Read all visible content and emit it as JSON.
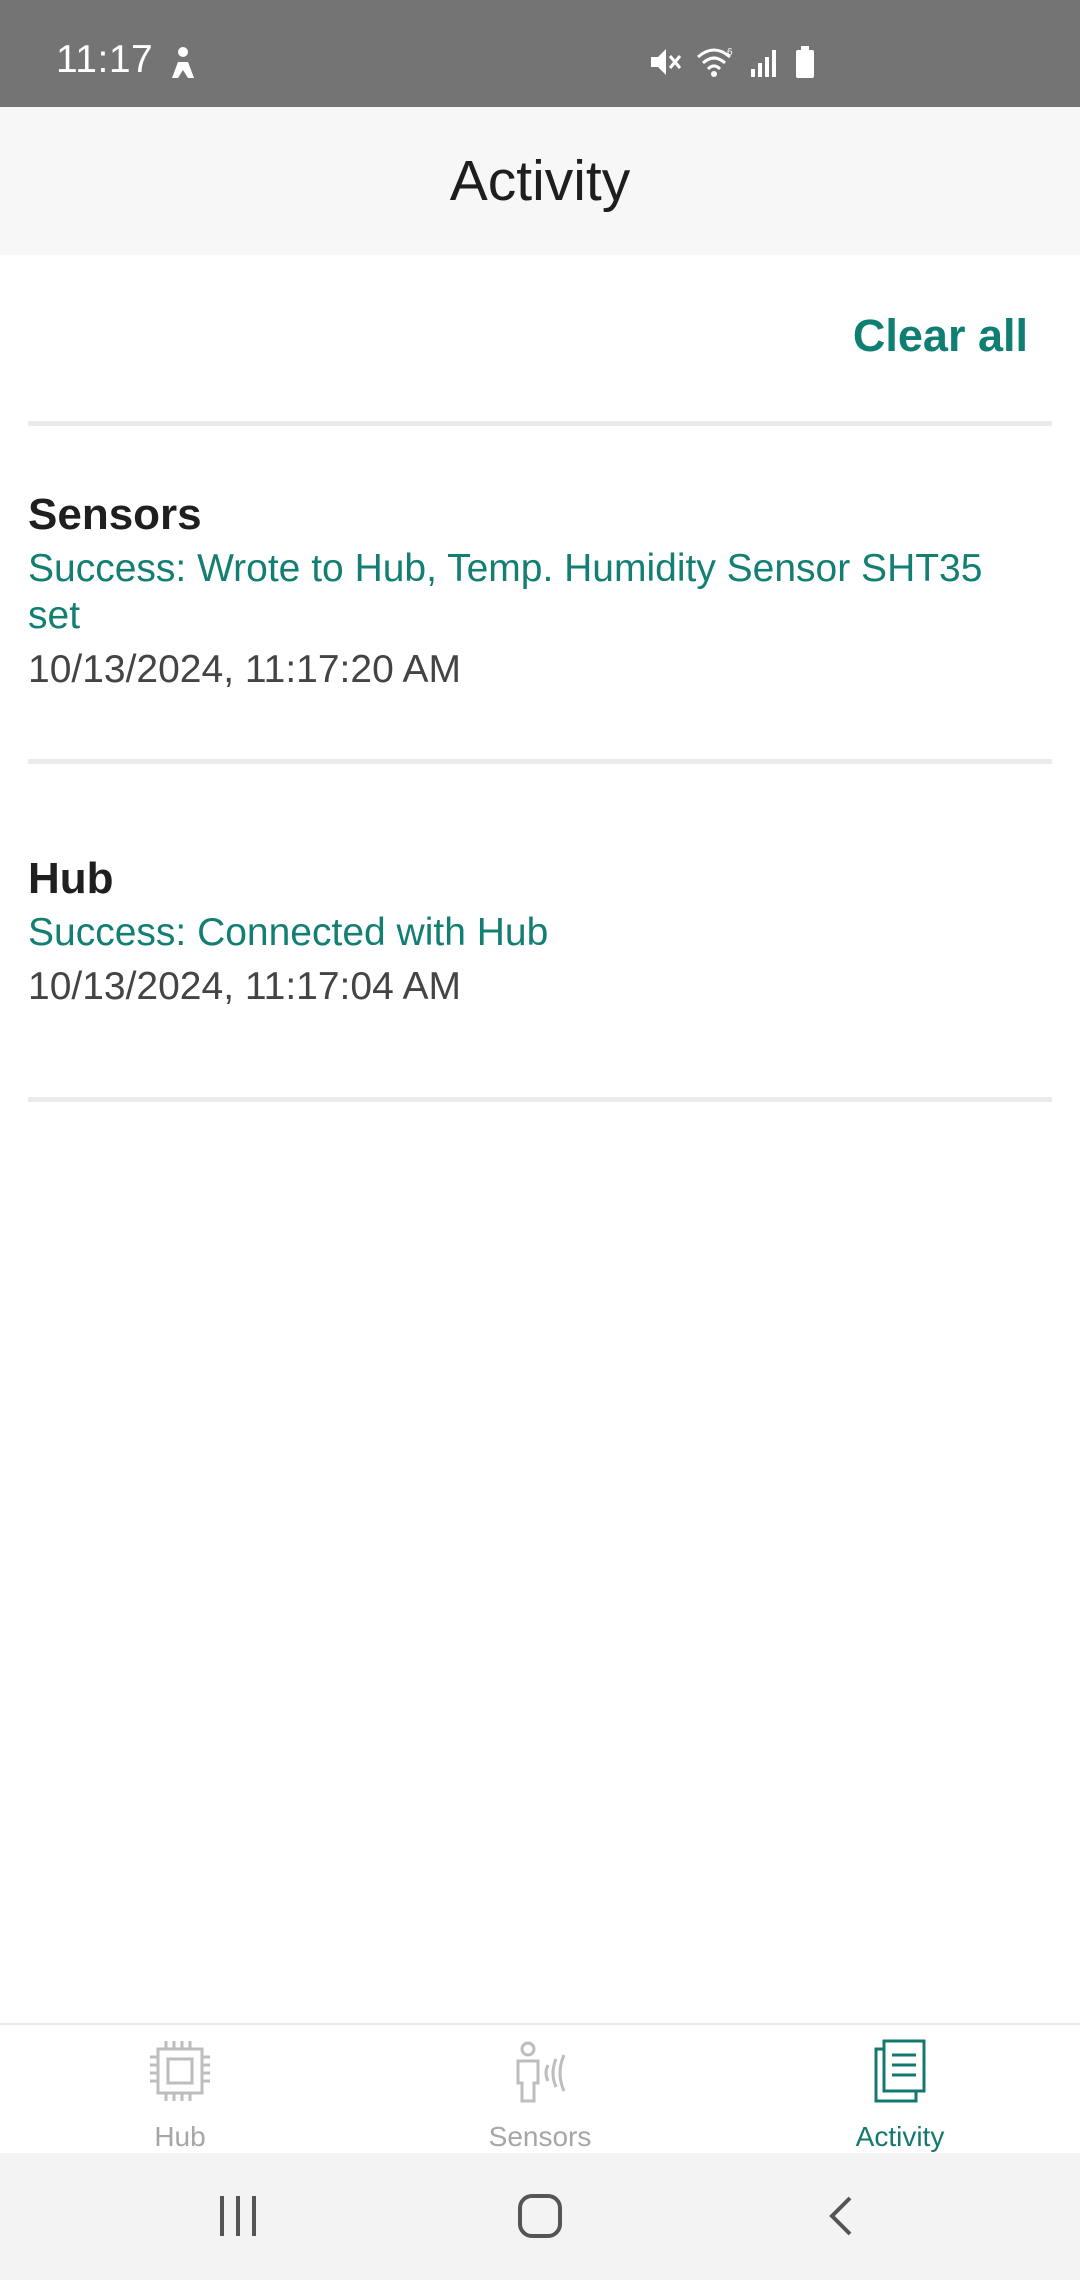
{
  "status_bar": {
    "time": "11:17",
    "icons": [
      "accessibility-icon",
      "mute-icon",
      "wifi-icon",
      "signal-icon",
      "battery-icon"
    ]
  },
  "header": {
    "title": "Activity"
  },
  "actions": {
    "clear_all": "Clear all"
  },
  "activity": [
    {
      "source": "Sensors",
      "message": "Success: Wrote to Hub, Temp. Humidity Sensor SHT35 set",
      "time": "10/13/2024, 11:17:20 AM"
    },
    {
      "source": "Hub",
      "message": "Success: Connected with Hub",
      "time": "10/13/2024, 11:17:04 AM"
    }
  ],
  "bottom_nav": {
    "items": [
      {
        "label": "Hub",
        "icon": "chip-icon",
        "active": false
      },
      {
        "label": "Sensors",
        "icon": "person-wave-icon",
        "active": false
      },
      {
        "label": "Activity",
        "icon": "document-icon",
        "active": true
      }
    ]
  },
  "system_nav": [
    "recent-apps",
    "home",
    "back"
  ],
  "colors": {
    "accent": "#0f7f73",
    "status_bar": "#747474",
    "inactive": "#a6a6a6"
  }
}
